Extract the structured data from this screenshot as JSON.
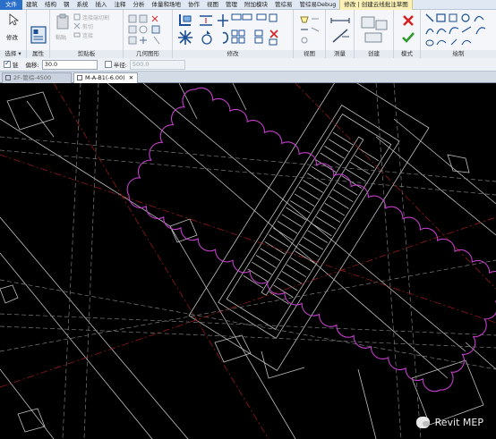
{
  "menu": {
    "items": [
      "文件",
      "建筑",
      "结构",
      "钢",
      "系统",
      "插入",
      "注释",
      "分析",
      "体量和场地",
      "协作",
      "视图",
      "管理",
      "附加模块",
      "管综易",
      "管综易Debug",
      "修改 | 创建云线批注草图"
    ],
    "active_index": 15
  },
  "ribbon": {
    "modify_label": "修改",
    "clipboard": {
      "paste_label": "粘贴",
      "join_label": "连接端切割",
      "cut_label": "剪切",
      "join2_label": "连接"
    },
    "panels": {
      "select": "选择",
      "properties": "属性",
      "clipboard": "剪贴板",
      "geometry": "几何图形",
      "modify": "修改",
      "view": "视图",
      "measure": "测量",
      "create": "创建",
      "mode": "模式",
      "draw": "绘制"
    },
    "colors": {
      "cancel": "#d42222",
      "finish": "#2f9a2f"
    }
  },
  "options": {
    "chain_label": "链",
    "chain_checked": true,
    "offset_label": "偏移:",
    "offset_value": "30.0",
    "radius_label": "半径:",
    "radius_checked": false,
    "radius_value": "500.0"
  },
  "tabs": [
    {
      "label": "2F-管综-4500",
      "active": false
    },
    {
      "label": "M-A-B1(-6.00)",
      "active": true
    }
  ],
  "canvas": {
    "background": "#000000",
    "revision_cloud_color": "#c33ec9",
    "watermark": "Revit MEP"
  }
}
